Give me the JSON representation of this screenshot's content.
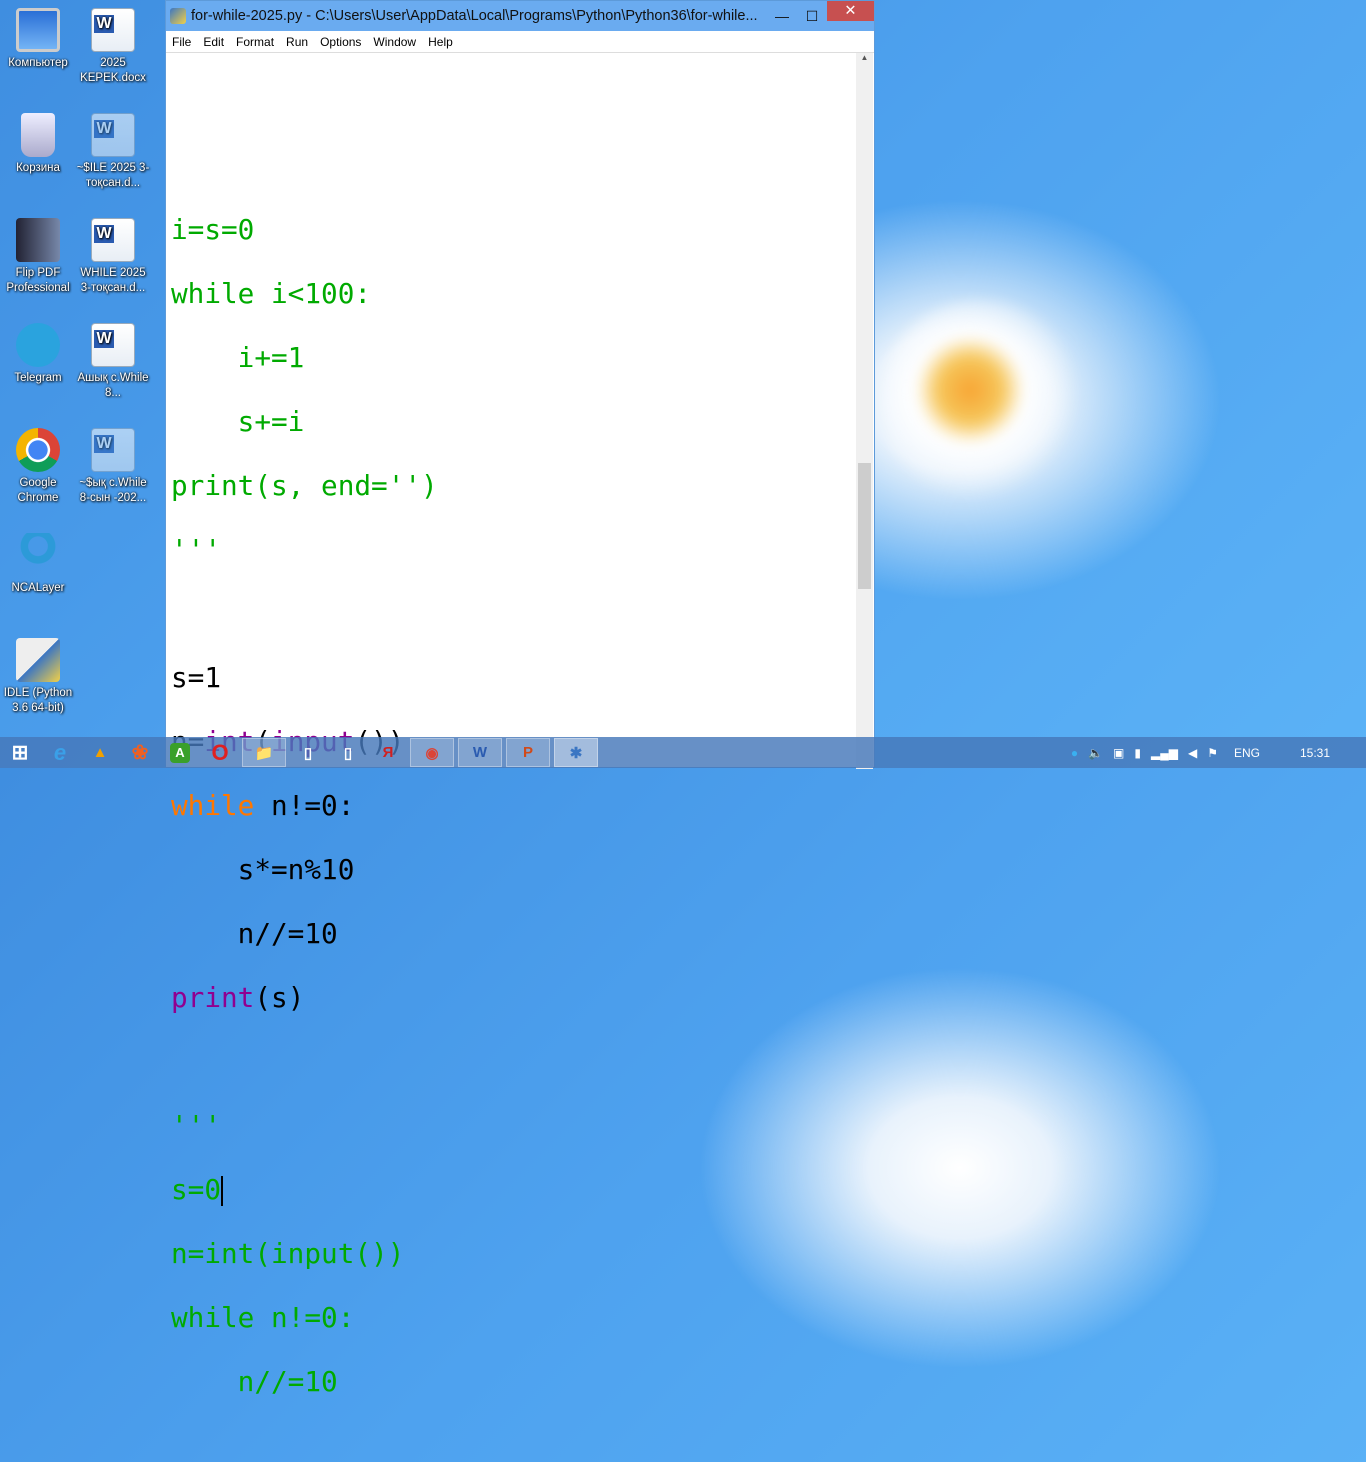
{
  "desktop": {
    "icons": [
      {
        "label": "Компьютер",
        "icon": "computer-icon"
      },
      {
        "label": "2025 KEPEK.docx",
        "icon": "word-doc-icon"
      },
      {
        "label": "Корзина",
        "icon": "recycle-bin-icon"
      },
      {
        "label": "~$ILE 2025 3-тоқсан.d...",
        "icon": "word-doc-icon"
      },
      {
        "label": "Flip PDF Professional",
        "icon": "flip-pdf-icon"
      },
      {
        "label": "WHILE 2025 3-тоқсан.d...",
        "icon": "word-doc-icon"
      },
      {
        "label": "Telegram",
        "icon": "telegram-icon"
      },
      {
        "label": "Ашық с.While 8...",
        "icon": "word-doc-icon"
      },
      {
        "label": "Google Chrome",
        "icon": "chrome-icon"
      },
      {
        "label": "~$ық с.While 8-сын -202...",
        "icon": "word-doc-icon"
      },
      {
        "label": "NCALayer",
        "icon": "ncalayer-icon"
      },
      {
        "label": "IDLE (Python 3.6 64-bit)",
        "icon": "idle-icon"
      }
    ]
  },
  "window": {
    "title": "for-while-2025.py - C:\\Users\\User\\AppData\\Local\\Programs\\Python\\Python36\\for-while...",
    "menu": [
      "File",
      "Edit",
      "Format",
      "Run",
      "Options",
      "Window",
      "Help"
    ]
  },
  "code": {
    "l1": "i=s=0",
    "l2": "while i<100:",
    "l3": "    i+=1",
    "l4": "    s+=i",
    "l5": "print(s, end='')",
    "l6": "'''",
    "l8": "s=1",
    "l9a": "n=",
    "l9b": "int",
    "l9c": "(",
    "l9d": "input",
    "l9e": "())",
    "l10a": "while",
    " l10b": " n!=0:",
    "l11": "    s*=n%10",
    "l12": "    n//=10",
    "l13a": "print",
    "l13b": "(s)",
    "l15": "'''",
    "l16": "s=0",
    "l17": "n=int(input())",
    "l18": "while n!=0:",
    "l19": "    n//=10"
  },
  "colors": {
    "string": "#00aa00",
    "keyword": "#ff7700",
    "builtin": "#900090"
  },
  "taskbar": {
    "apps": [
      "start",
      "internet-explorer",
      "aimp",
      "player",
      "ace",
      "opera",
      "file-explorer",
      "document",
      "document",
      "yandex",
      "chrome",
      "word",
      "powerpoint",
      "idle"
    ]
  },
  "tray": {
    "language": "ENG",
    "time": "15:31"
  }
}
